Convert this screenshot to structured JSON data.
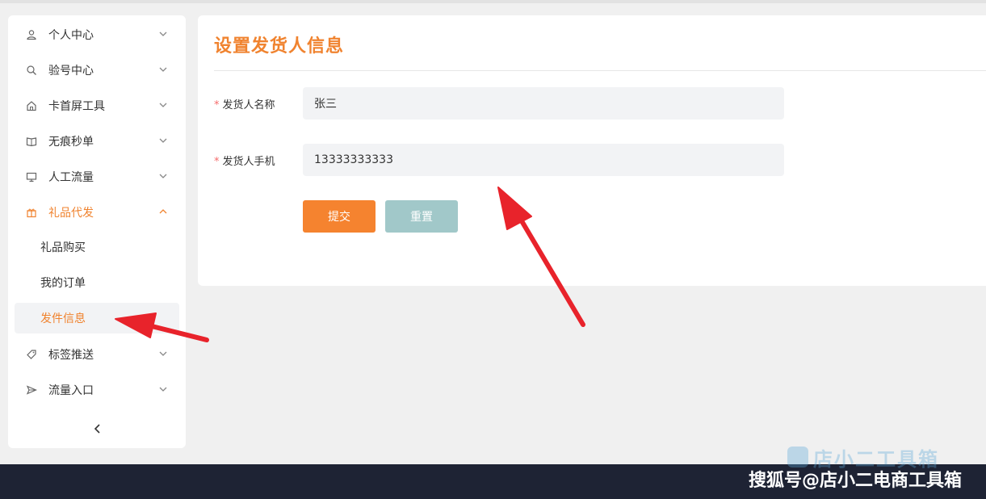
{
  "sidebar": {
    "items": [
      {
        "label": "个人中心",
        "icon": "user-icon"
      },
      {
        "label": "验号中心",
        "icon": "search-icon"
      },
      {
        "label": "卡首屏工具",
        "icon": "home-icon"
      },
      {
        "label": "无痕秒单",
        "icon": "book-icon"
      },
      {
        "label": "人工流量",
        "icon": "monitor-icon"
      },
      {
        "label": "礼品代发",
        "icon": "gift-icon",
        "expanded": true
      },
      {
        "label": "标签推送",
        "icon": "tag-icon"
      },
      {
        "label": "流量入口",
        "icon": "send-icon"
      }
    ],
    "sub_items": [
      {
        "label": "礼品购买"
      },
      {
        "label": "我的订单"
      },
      {
        "label": "发件信息",
        "selected": true
      }
    ]
  },
  "main": {
    "title": "设置发货人信息",
    "form": {
      "name_label": "发货人名称",
      "name_value": "张三",
      "phone_label": "发货人手机",
      "phone_value": "13333333333",
      "required_mark": "*"
    },
    "submit_label": "提交",
    "reset_label": "重置"
  },
  "watermark": {
    "logo_text": "店小二工具箱",
    "caption": "搜狐号@店小二电商工具箱"
  },
  "colors": {
    "accent": "#f0832f",
    "submit": "#f5832f",
    "reset": "#a1c8c9",
    "bottom_bar": "#1e2334",
    "annotation_arrow": "#e8232b"
  }
}
